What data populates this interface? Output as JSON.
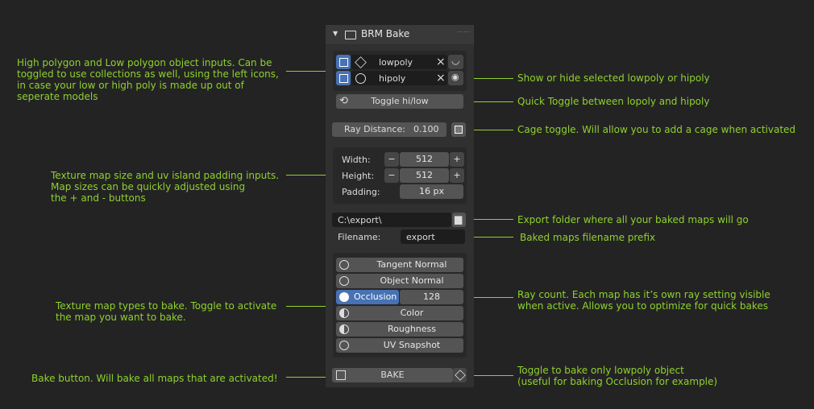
{
  "panel": {
    "title": "BRM Bake",
    "lowpoly": "lowpoly",
    "hipoly": "hipoly",
    "toggle_label": "Toggle hi/low",
    "ray_distance_label": "Ray Distance:",
    "ray_distance_value": "0.100",
    "width_label": "Width:",
    "width_value": "512",
    "height_label": "Height:",
    "height_value": "512",
    "padding_label": "Padding:",
    "padding_value": "16 px",
    "folder_value": "C:\\export\\",
    "filename_label": "Filename:",
    "filename_value": "export",
    "maps": [
      "Tangent Normal",
      "Object Normal",
      "Occlusion",
      "Color",
      "Roughness",
      "UV Snapshot"
    ],
    "occlusion_rays": "128",
    "bake_label": "BAKE",
    "minus": "−",
    "plus": "+",
    "clear": "×"
  },
  "annotations": {
    "hilo_inputs": "High polygon and Low polygon object inputs. Can be\ntoggled to use collections as well, using the left icons,\nin case your low or high poly is made up out of\nseperate models",
    "show_hide": "Show or hide selected lowpoly or hipoly",
    "quick_toggle": "Quick Toggle between lopoly and hipoly",
    "cage": "Cage toggle. Will allow you to add a cage when activated",
    "texture_size": "Texture map size and uv island padding inputs.\nMap sizes can be quickly adjusted using\nthe + and - buttons",
    "export_folder": "Export folder where all your baked maps will go",
    "prefix": "Baked maps filename prefix",
    "ray_count": "Ray count. Each map has it’s own ray setting visible\nwhen active. Allows you to optimize for quick bakes",
    "map_types": "Texture map types to bake. Toggle to activate\nthe map you want to bake.",
    "bake_button": "Bake button. Will bake all maps that are activated!",
    "lowpoly_only": "Toggle to bake only lowpoly object\n(useful for baking Occlusion for example)"
  }
}
